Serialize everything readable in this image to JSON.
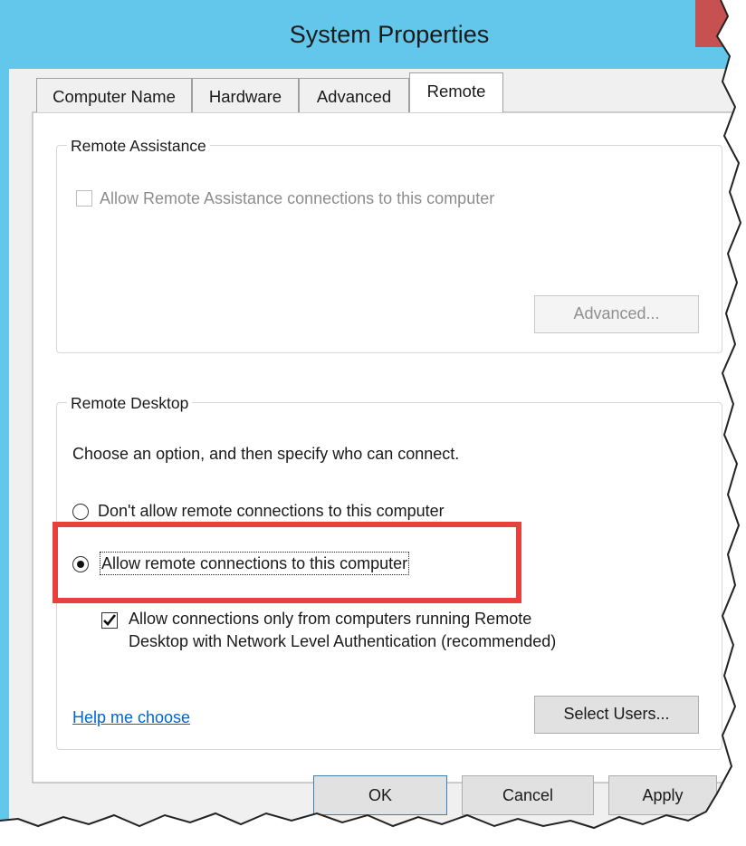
{
  "window": {
    "title": "System Properties"
  },
  "tabs": [
    {
      "label": "Computer Name",
      "active": false
    },
    {
      "label": "Hardware",
      "active": false
    },
    {
      "label": "Advanced",
      "active": false
    },
    {
      "label": "Remote",
      "active": true
    }
  ],
  "remote_assistance": {
    "group_title": "Remote Assistance",
    "checkbox_label": "Allow Remote Assistance connections to this computer",
    "checkbox_checked": false,
    "checkbox_enabled": false,
    "advanced_button": "Advanced..."
  },
  "remote_desktop": {
    "group_title": "Remote Desktop",
    "instruction": "Choose an option, and then specify who can connect.",
    "option_dont_allow": "Don't allow remote connections to this computer",
    "option_allow": "Allow remote connections to this computer",
    "selected_option": "allow",
    "nla_line1": "Allow connections only from computers running Remote",
    "nla_line2": "Desktop with Network Level Authentication (recommended)",
    "nla_checked": true,
    "help_link": "Help me choose",
    "select_users_button": "Select Users..."
  },
  "footer": {
    "ok_button": "OK",
    "cancel_button": "Cancel",
    "apply_button": "Apply"
  },
  "colors": {
    "titlebar": "#62c7ea",
    "close_button": "#c75050",
    "highlight": "#e8403d",
    "link": "#0066cc"
  },
  "icons": {
    "checked": "checkmark-icon",
    "radio_selected": "radio-dot-icon"
  }
}
